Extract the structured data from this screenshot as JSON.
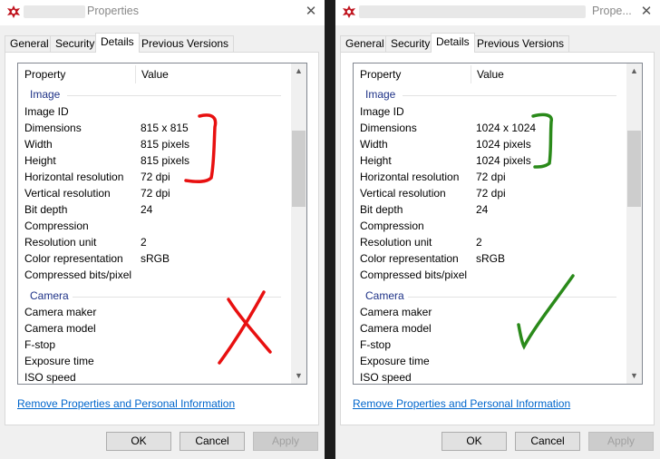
{
  "left": {
    "title": "Properties",
    "tabs": [
      "General",
      "Security",
      "Details",
      "Previous Versions"
    ],
    "columns": {
      "property": "Property",
      "value": "Value"
    },
    "image_group": "Image",
    "image_rows": [
      {
        "property": "Image ID",
        "value": ""
      },
      {
        "property": "Dimensions",
        "value": "815 x 815"
      },
      {
        "property": "Width",
        "value": "815 pixels"
      },
      {
        "property": "Height",
        "value": "815 pixels"
      },
      {
        "property": "Horizontal resolution",
        "value": "72 dpi"
      },
      {
        "property": "Vertical resolution",
        "value": "72 dpi"
      },
      {
        "property": "Bit depth",
        "value": "24"
      },
      {
        "property": "Compression",
        "value": ""
      },
      {
        "property": "Resolution unit",
        "value": "2"
      },
      {
        "property": "Color representation",
        "value": "sRGB"
      },
      {
        "property": "Compressed bits/pixel",
        "value": ""
      }
    ],
    "camera_group": "Camera",
    "camera_rows": [
      {
        "property": "Camera maker",
        "value": ""
      },
      {
        "property": "Camera model",
        "value": ""
      },
      {
        "property": "F-stop",
        "value": ""
      },
      {
        "property": "Exposure time",
        "value": ""
      },
      {
        "property": "ISO speed",
        "value": ""
      }
    ],
    "link": "Remove Properties and Personal Information",
    "buttons": {
      "ok": "OK",
      "cancel": "Cancel",
      "apply": "Apply"
    },
    "annotation_color": "#e81010"
  },
  "right": {
    "title": "Prope...",
    "tabs": [
      "General",
      "Security",
      "Details",
      "Previous Versions"
    ],
    "columns": {
      "property": "Property",
      "value": "Value"
    },
    "image_group": "Image",
    "image_rows": [
      {
        "property": "Image ID",
        "value": ""
      },
      {
        "property": "Dimensions",
        "value": "1024 x 1024"
      },
      {
        "property": "Width",
        "value": "1024 pixels"
      },
      {
        "property": "Height",
        "value": "1024 pixels"
      },
      {
        "property": "Horizontal resolution",
        "value": "72 dpi"
      },
      {
        "property": "Vertical resolution",
        "value": "72 dpi"
      },
      {
        "property": "Bit depth",
        "value": "24"
      },
      {
        "property": "Compression",
        "value": ""
      },
      {
        "property": "Resolution unit",
        "value": "2"
      },
      {
        "property": "Color representation",
        "value": "sRGB"
      },
      {
        "property": "Compressed bits/pixel",
        "value": ""
      }
    ],
    "camera_group": "Camera",
    "camera_rows": [
      {
        "property": "Camera maker",
        "value": ""
      },
      {
        "property": "Camera model",
        "value": ""
      },
      {
        "property": "F-stop",
        "value": ""
      },
      {
        "property": "Exposure time",
        "value": ""
      },
      {
        "property": "ISO speed",
        "value": ""
      }
    ],
    "link": "Remove Properties and Personal Information",
    "buttons": {
      "ok": "OK",
      "cancel": "Cancel",
      "apply": "Apply"
    },
    "annotation_color": "#2a8a1a"
  }
}
